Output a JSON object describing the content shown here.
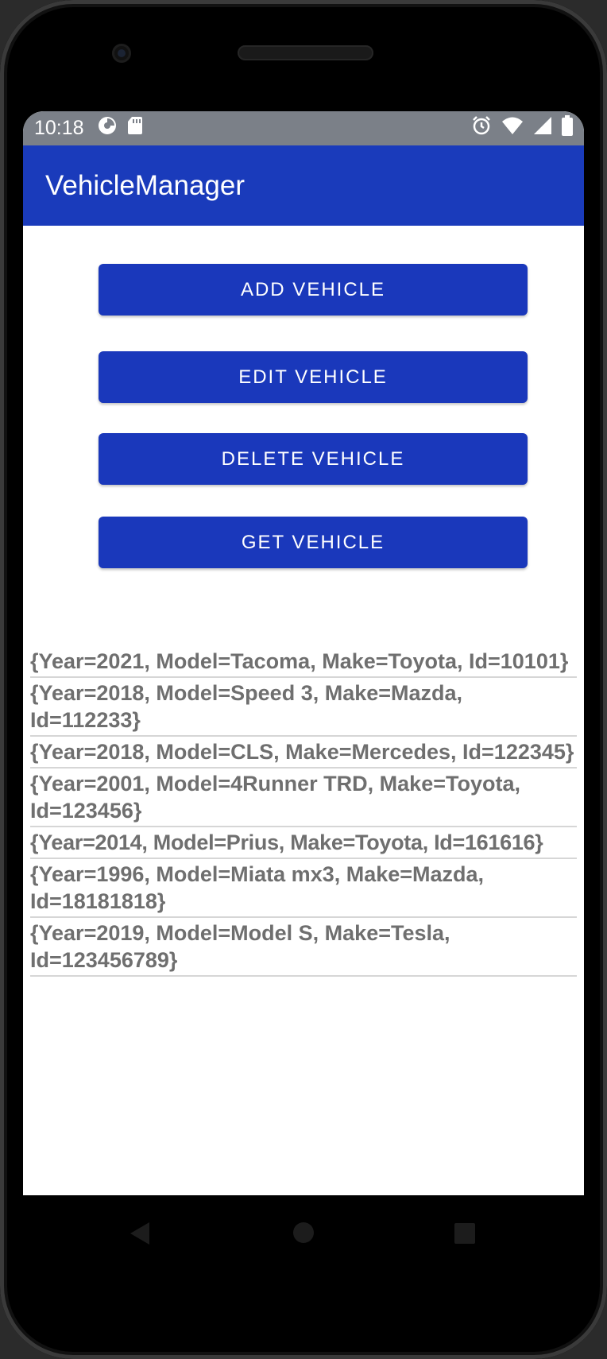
{
  "status_bar": {
    "time": "10:18",
    "icons": [
      "data-saver-icon",
      "sd-card-icon",
      "alarm-icon",
      "wifi-icon",
      "signal-icon",
      "battery-icon"
    ]
  },
  "app_bar": {
    "title": "VehicleManager"
  },
  "buttons": {
    "add": "ADD VEHICLE",
    "edit": "EDIT VEHICLE",
    "delete": "DELETE VEHICLE",
    "get": "GET VEHICLE"
  },
  "vehicles": [
    "{Year=2021, Model=Tacoma, Make=Toyota, Id=10101}",
    "{Year=2018, Model=Speed 3, Make=Mazda, Id=112233}",
    "{Year=2018, Model=CLS, Make=Mercedes, Id=122345}",
    "{Year=2001, Model=4Runner TRD, Make=Toyota, Id=123456}",
    "{Year=2014, Model=Prius, Make=Toyota, Id=161616}",
    "{Year=1996, Model=Miata mx3, Make=Mazda, Id=18181818}",
    "{Year=2019, Model=Model S, Make=Tesla, Id=123456789}"
  ],
  "nav": [
    "back-icon",
    "home-icon",
    "recents-icon"
  ],
  "colors": {
    "accent": "#1a38bb",
    "status_bar": "#7b8088",
    "list_text": "#6f6f6f"
  }
}
